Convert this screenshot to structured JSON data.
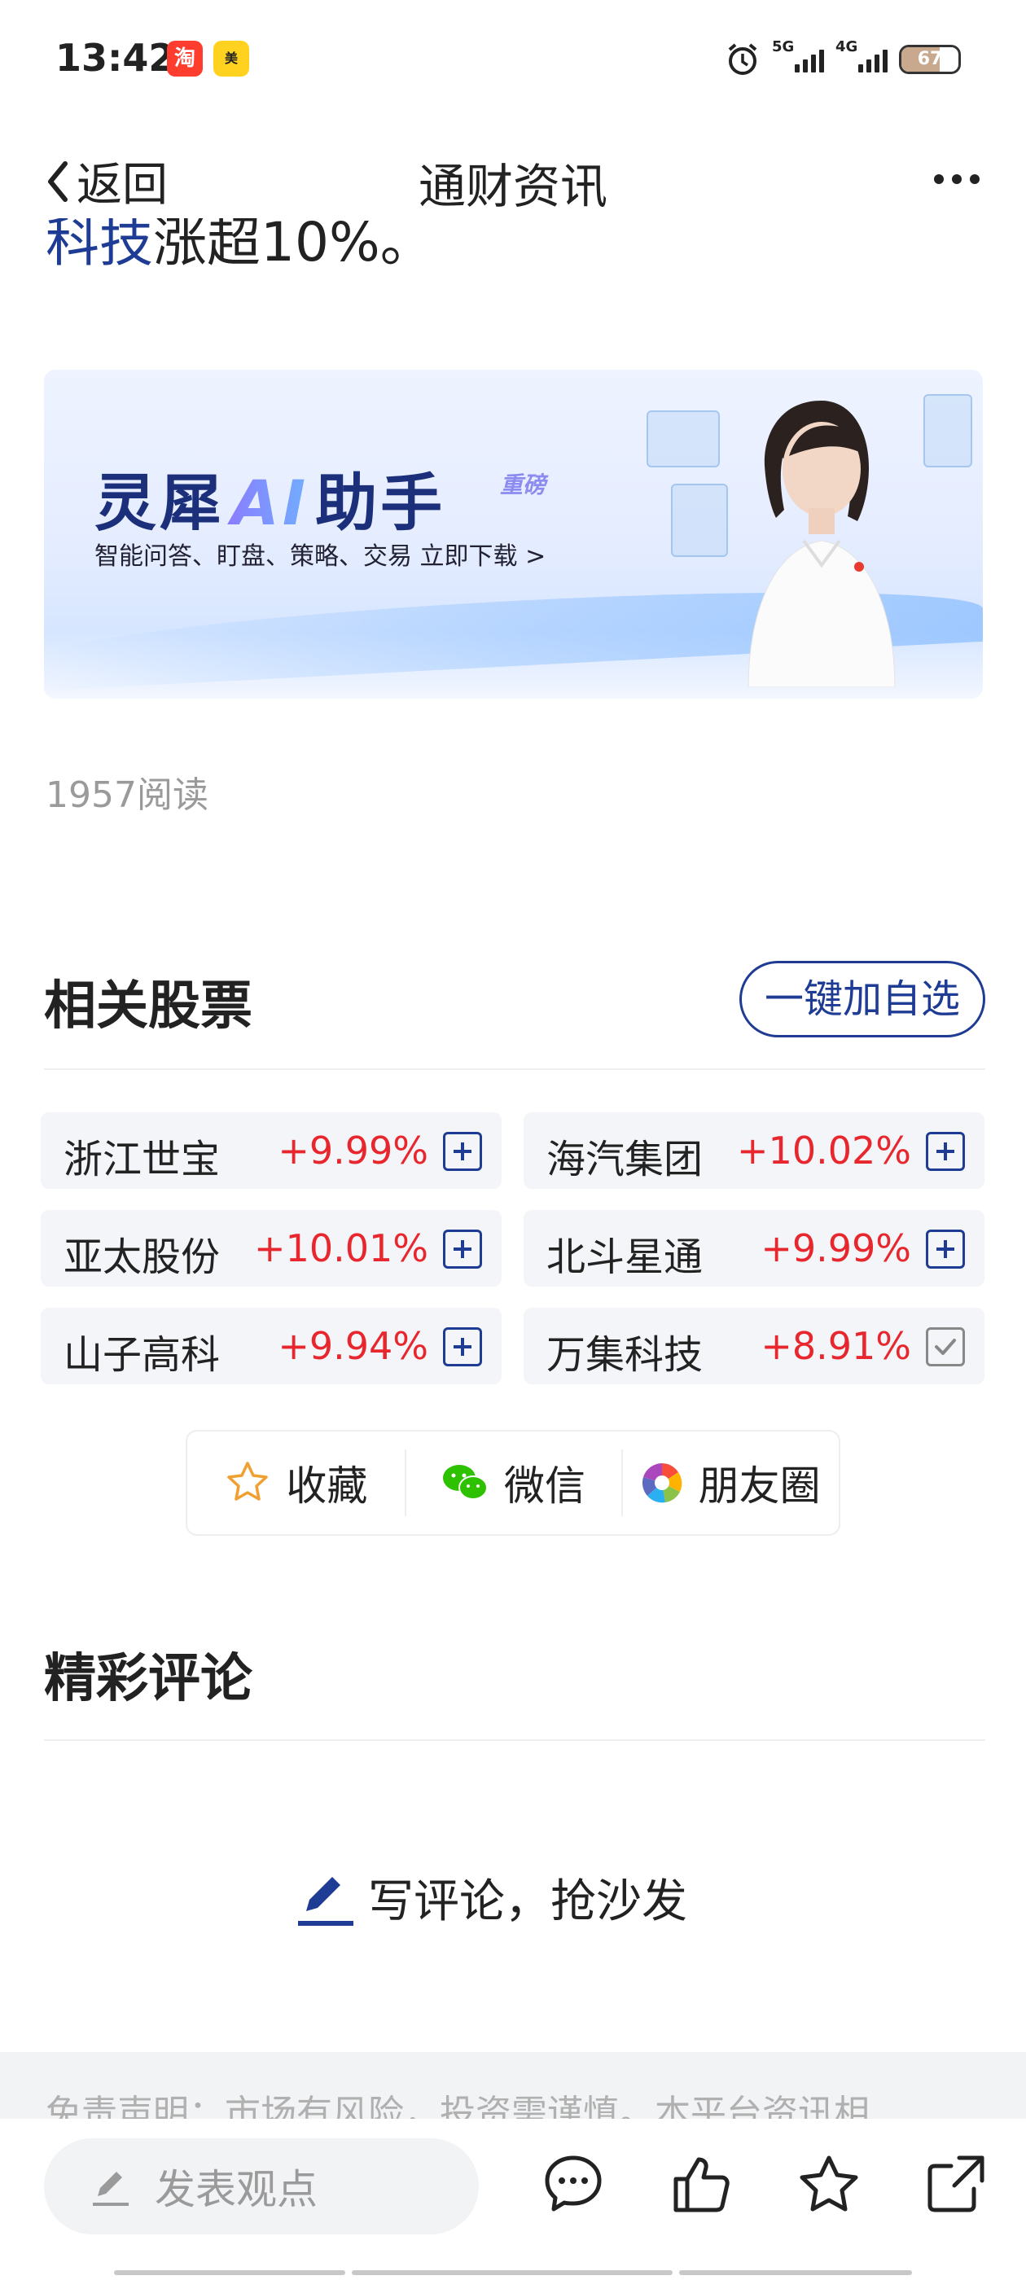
{
  "status_bar": {
    "time": "13:42",
    "net1": "5G",
    "net2": "4G",
    "battery": "67",
    "battery_level_percent": 67,
    "app_icons": [
      "taobao-icon",
      "meituan-icon"
    ]
  },
  "nav": {
    "back_label": "返回",
    "title": "通财资讯"
  },
  "article": {
    "tail_link": "科技",
    "tail_text": "涨超10%。"
  },
  "banner": {
    "title_pre": "灵犀",
    "title_ai": "AI",
    "title_post": "助手",
    "tag": "重磅",
    "subtitle": "智能问答、盯盘、策略、交易  立即下载 >"
  },
  "reads": "1957阅读",
  "related": {
    "title": "相关股票",
    "add_all_label": "一键加自选",
    "stocks": [
      {
        "name": "浙江世宝",
        "change": "+9.99%",
        "in_watchlist": false
      },
      {
        "name": "海汽集团",
        "change": "+10.02%",
        "in_watchlist": false
      },
      {
        "name": "亚太股份",
        "change": "+10.01%",
        "in_watchlist": false
      },
      {
        "name": "北斗星通",
        "change": "+9.99%",
        "in_watchlist": false
      },
      {
        "name": "山子高科",
        "change": "+9.94%",
        "in_watchlist": false
      },
      {
        "name": "万集科技",
        "change": "+8.91%",
        "in_watchlist": true
      }
    ]
  },
  "share": {
    "favorite": "收藏",
    "wechat": "微信",
    "moments": "朋友圈"
  },
  "comments": {
    "title": "精彩评论",
    "write_prompt": "写评论，抢沙发"
  },
  "disclaimer": "免责声明：市场有风险，投资需谨慎。本平台资讯相",
  "bottom": {
    "input_placeholder": "发表观点"
  },
  "colors": {
    "accent": "#1f3c94",
    "up": "#e8262d"
  }
}
